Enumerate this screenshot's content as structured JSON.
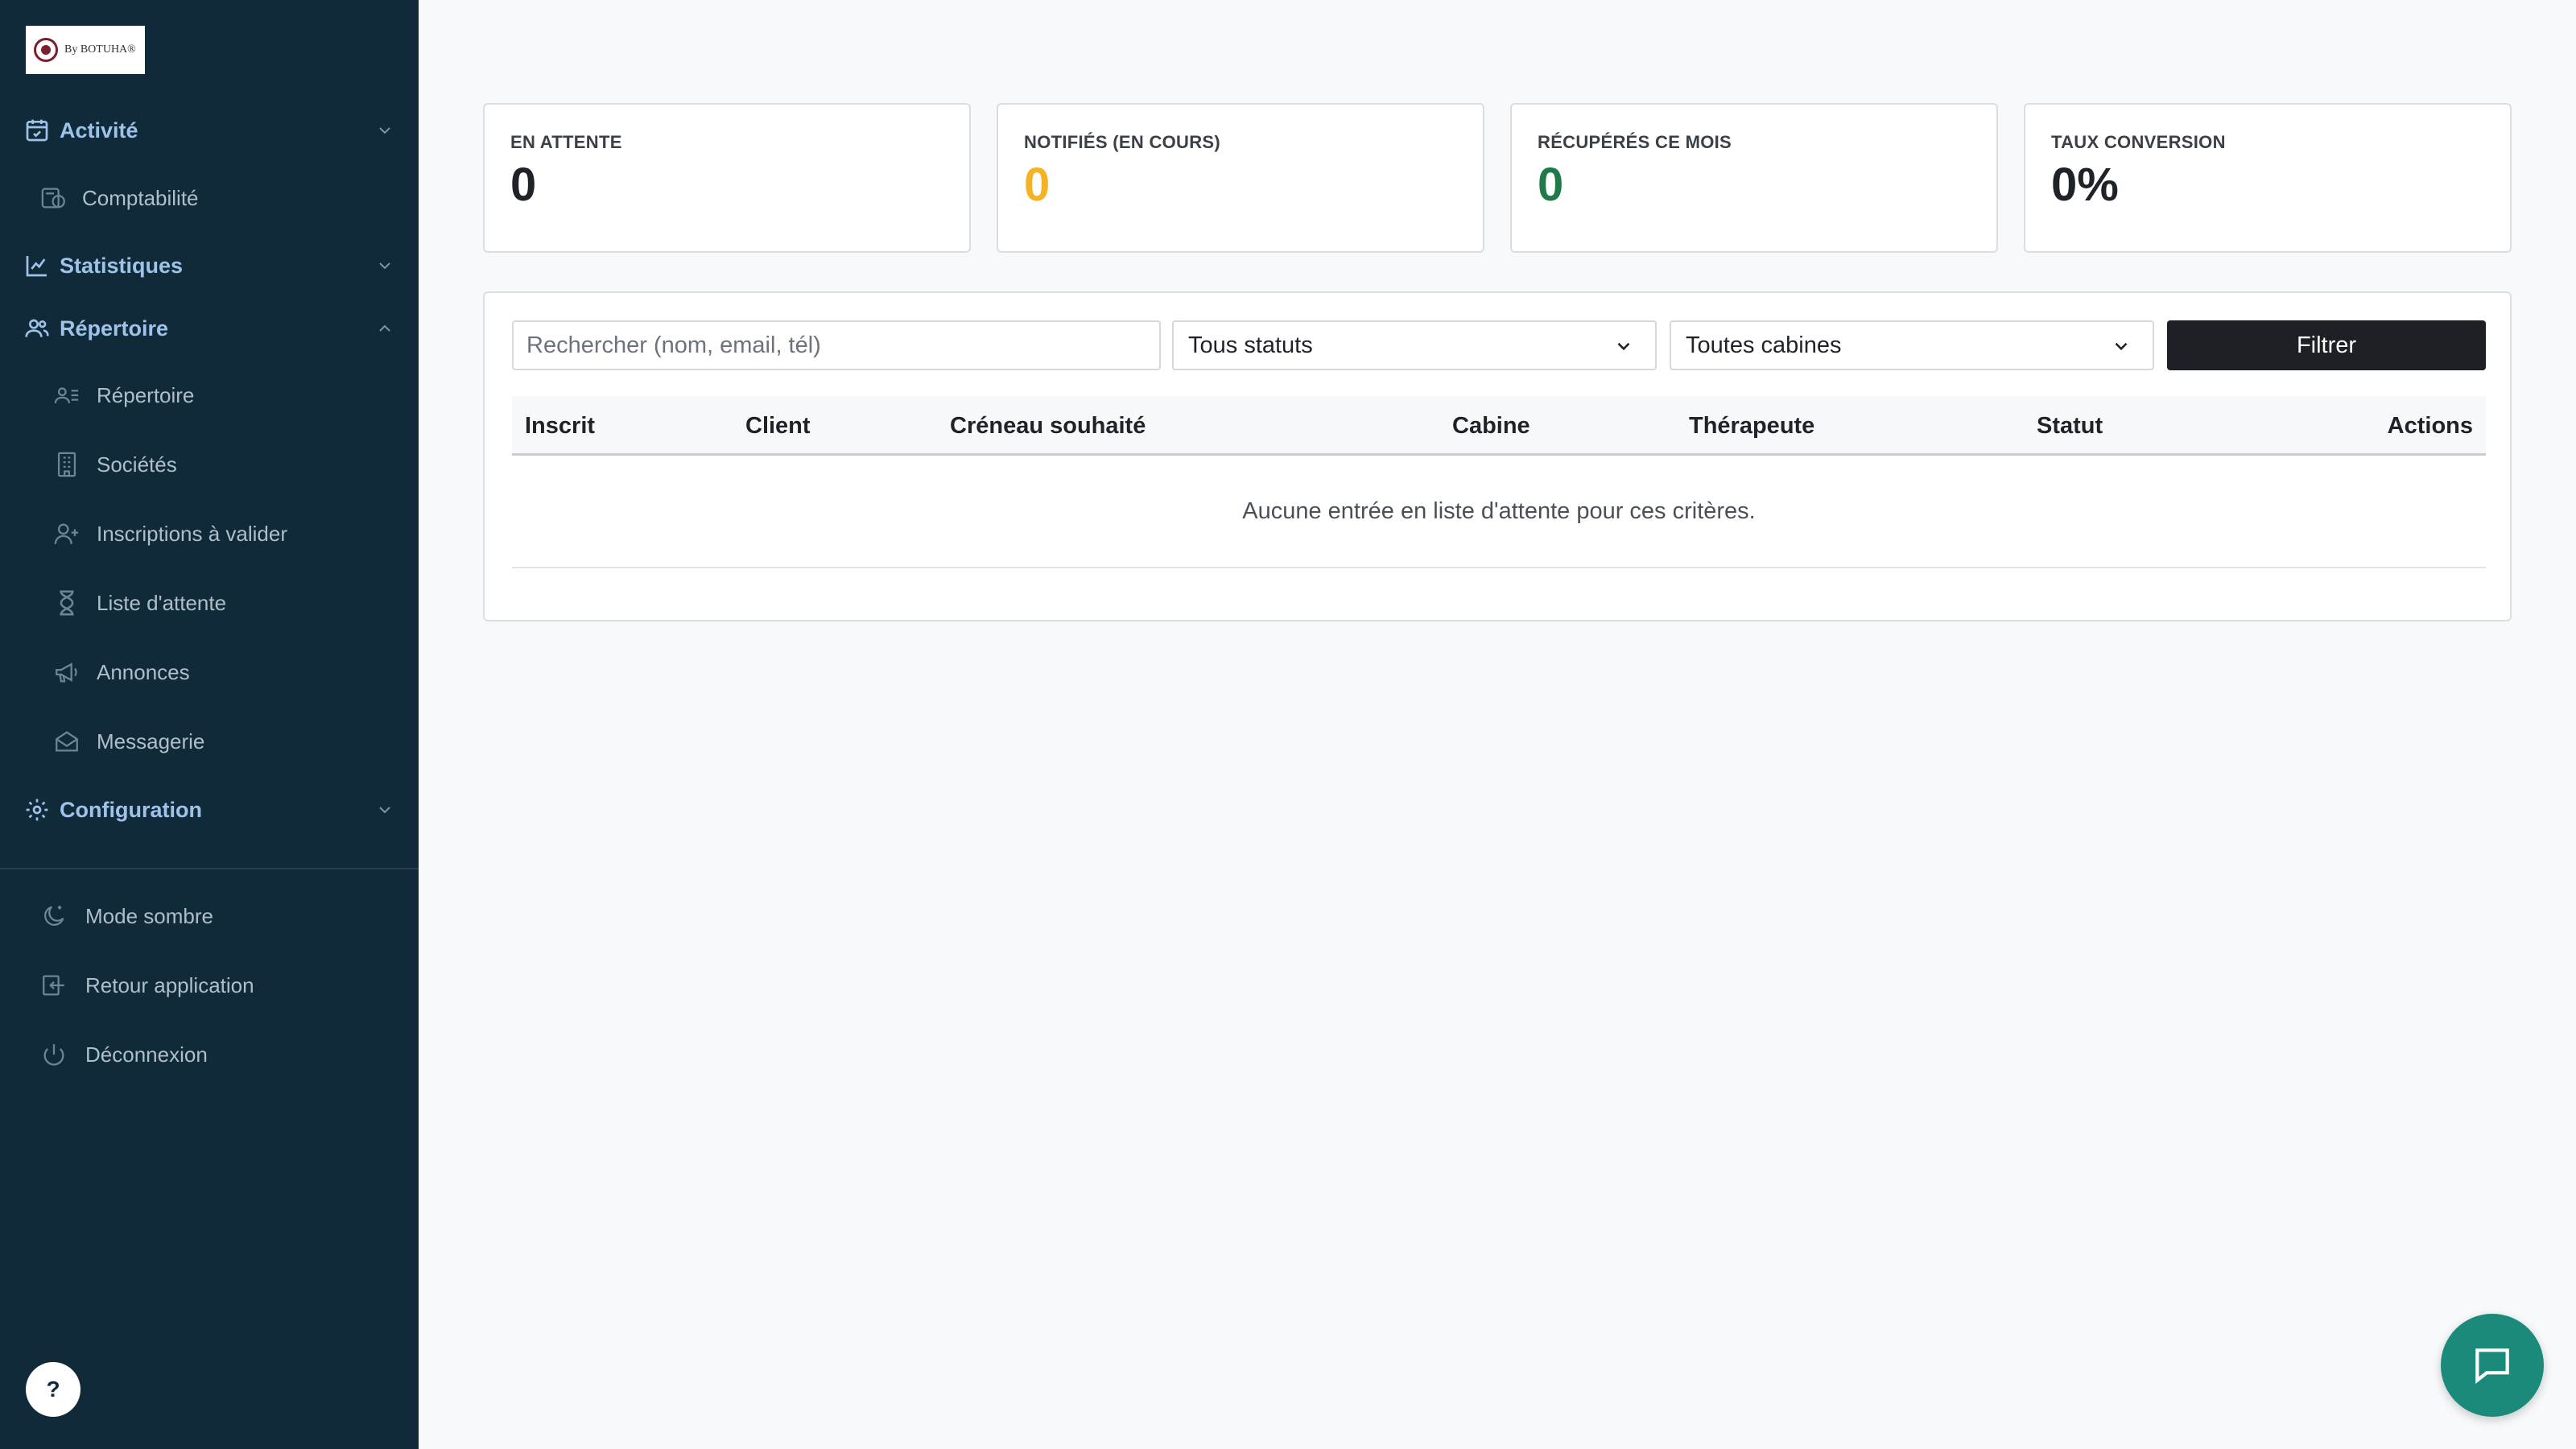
{
  "brand": {
    "logo_text": "By BOTUHA®"
  },
  "sidebar": {
    "sections": [
      {
        "label": "Activité",
        "icon": "calendar-check-icon",
        "expanded": false
      },
      {
        "label": "Statistiques",
        "icon": "chart-line-icon",
        "expanded": false
      },
      {
        "label": "Répertoire",
        "icon": "users-icon",
        "expanded": true
      },
      {
        "label": "Configuration",
        "icon": "gear-icon",
        "expanded": false
      }
    ],
    "items": [
      {
        "label": "Comptabilité",
        "icon": "accounting-icon"
      },
      {
        "label": "Répertoire",
        "icon": "address-book-icon"
      },
      {
        "label": "Sociétés",
        "icon": "building-icon"
      },
      {
        "label": "Inscriptions à valider",
        "icon": "user-plus-icon"
      },
      {
        "label": "Liste d'attente",
        "icon": "hourglass-icon"
      },
      {
        "label": "Annonces",
        "icon": "megaphone-icon"
      },
      {
        "label": "Messagerie",
        "icon": "envelope-icon"
      }
    ],
    "footer": [
      {
        "label": "Mode sombre",
        "icon": "moon-icon"
      },
      {
        "label": "Retour application",
        "icon": "return-icon"
      },
      {
        "label": "Déconnexion",
        "icon": "power-icon"
      }
    ],
    "help_label": "?"
  },
  "stats": [
    {
      "label": "EN ATTENTE",
      "value": "0",
      "color": "#1f2329"
    },
    {
      "label": "NOTIFIÉS (EN COURS)",
      "value": "0",
      "color": "#f5b324"
    },
    {
      "label": "RÉCUPÉRÉS CE MOIS",
      "value": "0",
      "color": "#1f7a4a"
    },
    {
      "label": "TAUX CONVERSION",
      "value": "0%",
      "color": "#1f2329"
    }
  ],
  "filters": {
    "search_placeholder": "Rechercher (nom, email, tél)",
    "search_value": "",
    "status_selected": "Tous statuts",
    "cabin_selected": "Toutes cabines",
    "filter_label": "Filtrer"
  },
  "table": {
    "columns": [
      "Inscrit",
      "Client",
      "Créneau souhaité",
      "Cabine",
      "Thérapeute",
      "Statut",
      "Actions"
    ],
    "rows": [],
    "empty_message": "Aucune entrée en liste d'attente pour ces critères."
  },
  "colors": {
    "sidebar_bg": "#112a3a",
    "section_label": "#9fc3e8",
    "accent_yellow": "#f5b324",
    "accent_green": "#1f7a4a",
    "primary_button": "#1d2125",
    "chat_fab": "#1b8a7a"
  }
}
